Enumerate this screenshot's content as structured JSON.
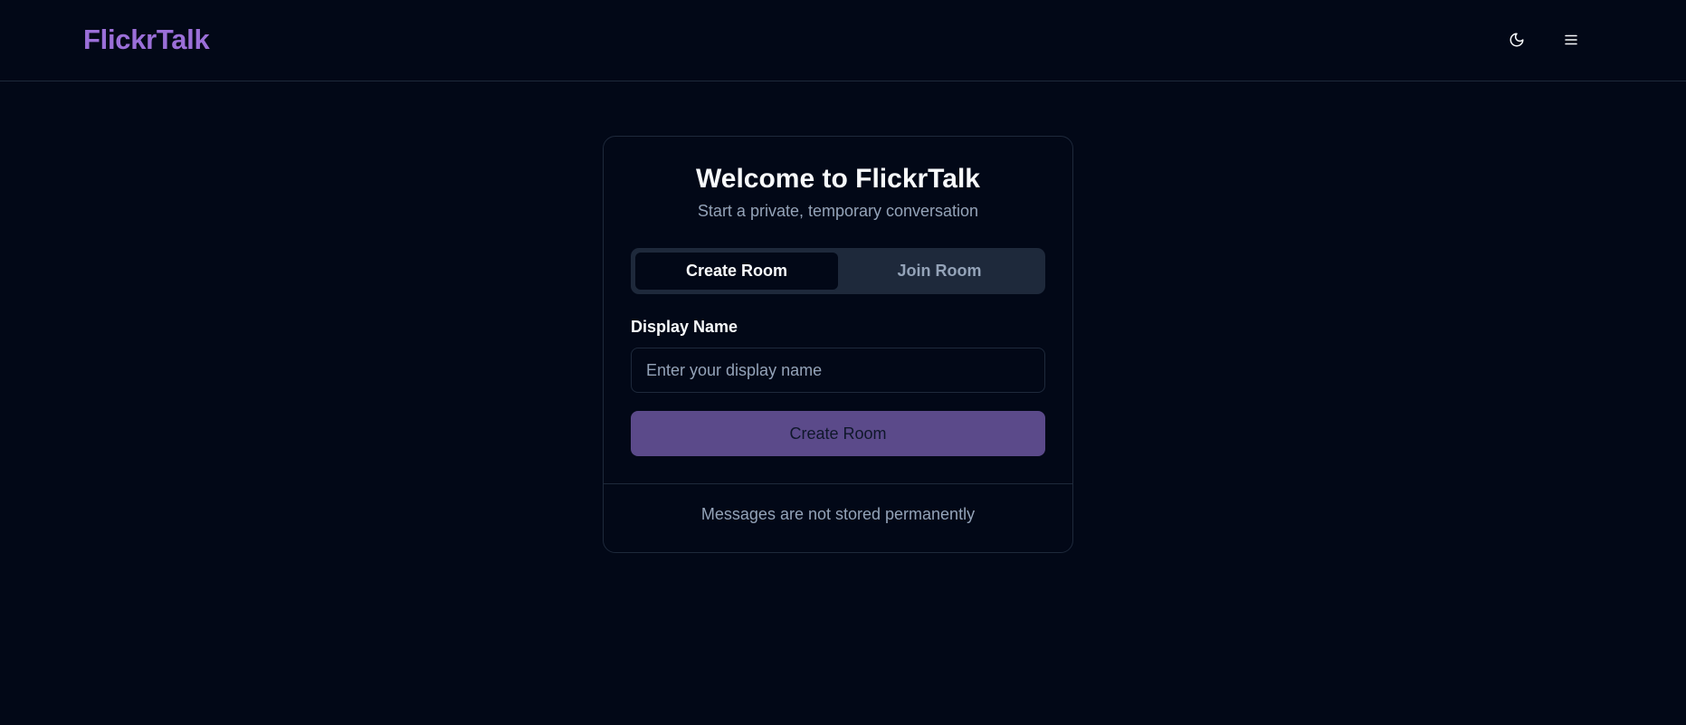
{
  "header": {
    "brand": "FlickrTalk",
    "theme_toggle_icon": "moon-icon",
    "menu_icon": "hamburger-menu-icon"
  },
  "card": {
    "title": "Welcome to FlickrTalk",
    "subtitle": "Start a private, temporary conversation",
    "tabs": [
      {
        "label": "Create Room",
        "active": true
      },
      {
        "label": "Join Room",
        "active": false
      }
    ],
    "display_name": {
      "label": "Display Name",
      "value": "",
      "placeholder": "Enter your display name"
    },
    "submit_label": "Create Room",
    "footer": "Messages are not stored permanently"
  },
  "colors": {
    "background": "#020817",
    "brand": "#9b6fd8",
    "border": "#1e293b",
    "primary_button": "#5b4a8a",
    "muted_text": "#94a3b8"
  }
}
